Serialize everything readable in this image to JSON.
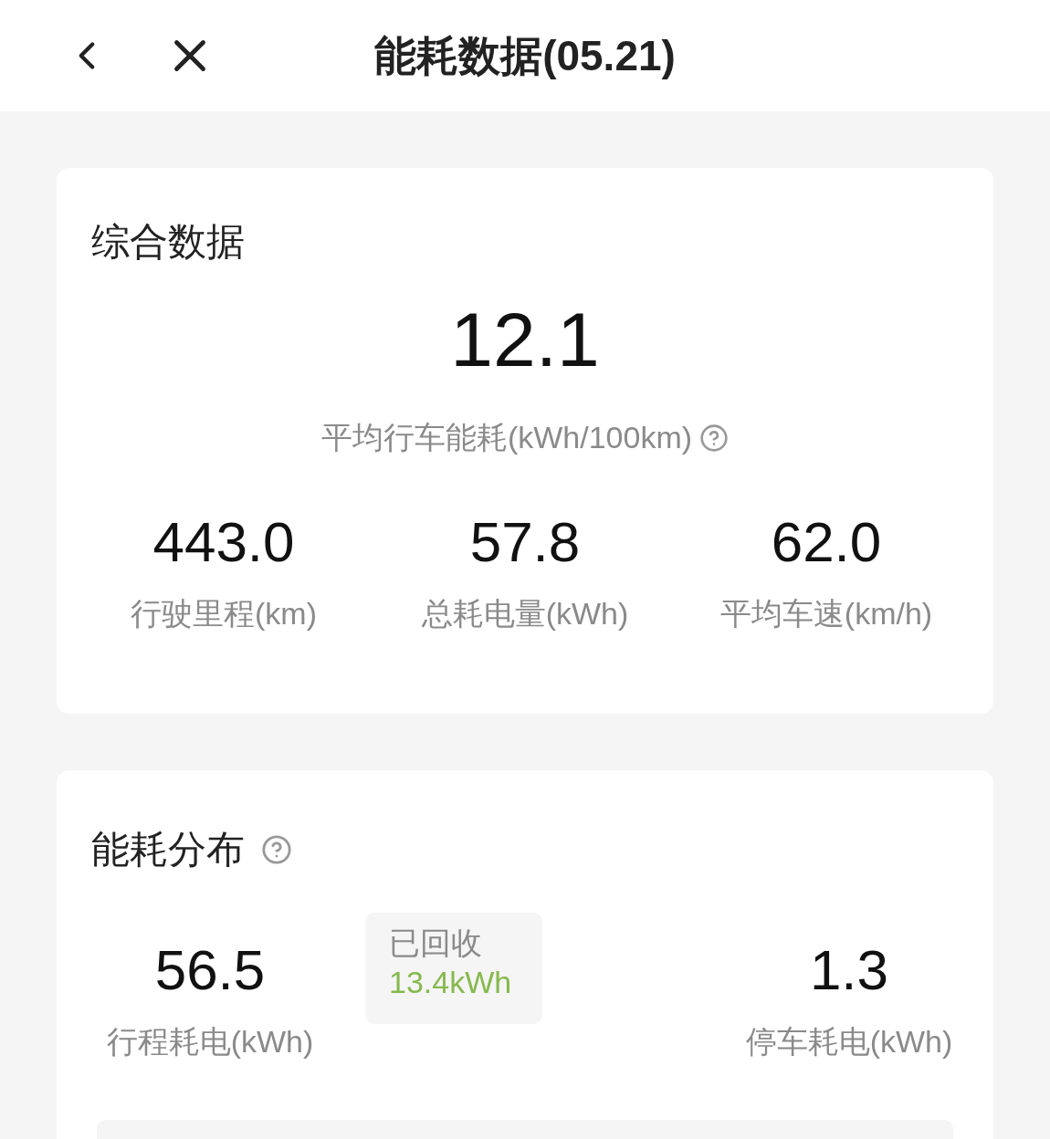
{
  "header": {
    "title": "能耗数据(05.21)"
  },
  "summary": {
    "title": "综合数据",
    "main_value": "12.1",
    "main_label": "平均行车能耗(kWh/100km)",
    "stats": [
      {
        "value": "443.0",
        "label": "行驶里程(km)"
      },
      {
        "value": "57.8",
        "label": "总耗电量(kWh)"
      },
      {
        "value": "62.0",
        "label": "平均车速(km/h)"
      }
    ]
  },
  "distribution": {
    "title": "能耗分布",
    "trip": {
      "value": "56.5",
      "label": "行程耗电(kWh)"
    },
    "recovered": {
      "label": "已回收",
      "value": "13.4kWh"
    },
    "parked": {
      "value": "1.3",
      "label": "停车耗电(kWh)"
    }
  }
}
